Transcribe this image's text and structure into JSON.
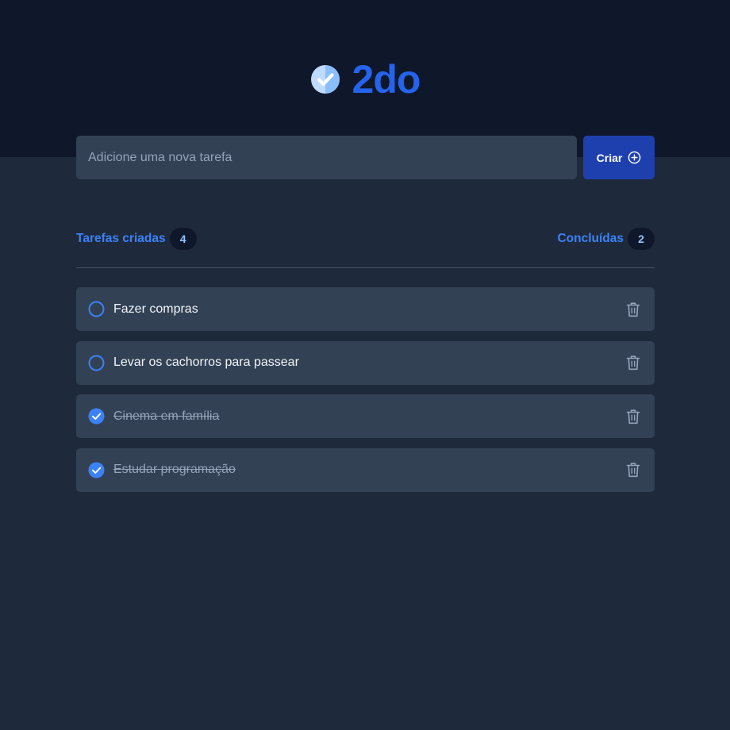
{
  "app": {
    "title": "2do"
  },
  "new_task": {
    "placeholder": "Adicione uma nova tarefa",
    "create_label": "Criar"
  },
  "counters": {
    "created_label": "Tarefas criadas",
    "created_count": "4",
    "done_label": "Concluídas",
    "done_count": "2"
  },
  "tasks": [
    {
      "text": "Fazer compras",
      "done": false
    },
    {
      "text": "Levar os cachorros para passear",
      "done": false
    },
    {
      "text": "Cinema em família",
      "done": true
    },
    {
      "text": "Estudar programação",
      "done": true
    }
  ],
  "colors": {
    "accent": "#2563eb",
    "button": "#1e40af",
    "header_bg": "#0f172a",
    "page_bg": "#1e293b",
    "card_bg": "#334155"
  },
  "icons": {
    "logo": "check-circle-icon",
    "create": "plus-circle-icon",
    "unchecked": "empty-circle-icon",
    "checked": "check-circle-icon",
    "delete": "trash-icon"
  }
}
